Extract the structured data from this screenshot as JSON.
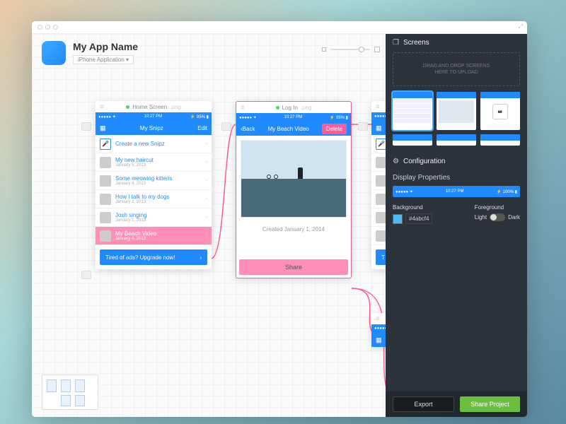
{
  "app": {
    "name": "My App Name",
    "subtitle": "iPhone Application"
  },
  "canvas": {
    "artboards": [
      {
        "id": "home",
        "title": "Home Screen",
        "ext": ".png",
        "status": {
          "time": "10:27 PM",
          "signal_label": "●●●●●",
          "wifi": "✦",
          "battery": "95%"
        },
        "nav": {
          "left_icon": "grid",
          "title": "My Snipz",
          "right": "Edit"
        },
        "items": [
          {
            "title": "Create a new Snipz",
            "sub": "",
            "icon": true
          },
          {
            "title": "My new haircut",
            "sub": "January 5, 2013"
          },
          {
            "title": "Some meowing kittens",
            "sub": "January 4, 2013"
          },
          {
            "title": "How I talk to my dogs",
            "sub": "January 2, 2013"
          },
          {
            "title": "Josh singing",
            "sub": "January 1, 2013"
          },
          {
            "title": "My Beach Video",
            "sub": "January 4, 2013",
            "highlighted": true
          }
        ],
        "banner": "Tired of ads? Upgrade now!"
      },
      {
        "id": "login",
        "title": "Log In",
        "ext": ".png",
        "status": {
          "time": "10:27 PM",
          "signal_label": "●●●●●",
          "wifi": "✦",
          "battery": "95%"
        },
        "nav": {
          "left": "Back",
          "title": "My Beach Video",
          "right": "Delete"
        },
        "created": "Created January 1, 2014",
        "share": "Share"
      }
    ]
  },
  "sidebar": {
    "screens_label": "Screens",
    "dropzone": "DRAG AND DROP SCREENS\nHERE TO UPLOAD",
    "config_label": "Configuration",
    "display_label": "Display Properties",
    "preview_status": {
      "time": "10:27 PM",
      "signal": "●●●●●",
      "wifi": "✦",
      "battery": "100%"
    },
    "background_label": "Background",
    "background_hex": "#4abcf4",
    "foreground_label": "Foreground",
    "fg_light": "Light",
    "fg_dark": "Dark",
    "export": "Export",
    "share_project": "Share Project"
  }
}
